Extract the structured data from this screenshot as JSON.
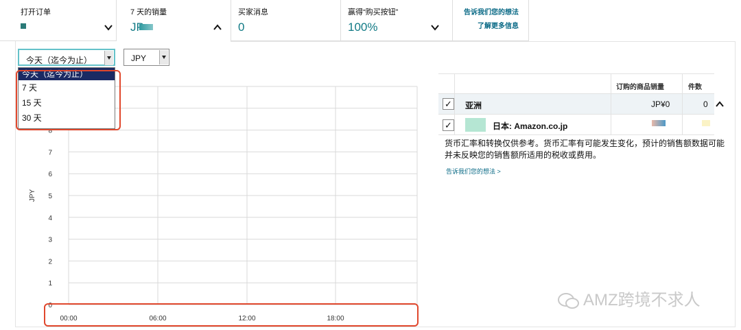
{
  "cards": [
    {
      "title": "打开订单",
      "value": "",
      "expanded": false
    },
    {
      "title": "7 天的销量",
      "value": "JP",
      "expanded": true
    },
    {
      "title": "买家消息",
      "value": "0",
      "expanded": false
    },
    {
      "title": "赢得“购买按钮”",
      "value": "100%",
      "expanded": false
    }
  ],
  "links": {
    "feedback": "告诉我们您的想法",
    "learn_more": "了解更多信息"
  },
  "range_select": {
    "value": "今天（迄今为止）"
  },
  "currency_select": {
    "value": "JPY"
  },
  "dropdown_options": [
    "今天（迄今为止）",
    "7 天",
    "15 天",
    "30 天"
  ],
  "table": {
    "headers": {
      "sales": "订购的商品销量",
      "units": "件数"
    },
    "rows": [
      {
        "label": "亚洲",
        "sales": "JP¥0",
        "units": "0",
        "checked": true
      },
      {
        "label": "日本: Amazon.co.jp",
        "sales": "",
        "units": "",
        "checked": true,
        "swatch": "#b5e6d3"
      }
    ]
  },
  "note": "货币汇率和转换仅供参考。货币汇率有可能发生变化，预计的销售额数据可能并未反映您的销售额所适用的税收或费用。",
  "feedback_link2": "告诉我们您的想法 >",
  "watermark": "AMZ跨境不求人",
  "colors": {
    "accent": "#117a85",
    "annotation": "#e0472c",
    "selected_option": "#1b2a63"
  },
  "chart_data": {
    "type": "line",
    "ylabel": "JPY",
    "ylim": [
      0,
      10
    ],
    "yticks": [
      0,
      1,
      2,
      3,
      4,
      5,
      6,
      7,
      8
    ],
    "xticks": [
      "00:00",
      "06:00",
      "12:00",
      "18:00"
    ],
    "series": [
      {
        "values": [
          0,
          0,
          0,
          0,
          0,
          0,
          0,
          0,
          0,
          0,
          0,
          0,
          0,
          0,
          0,
          0,
          0,
          0,
          0,
          0,
          0,
          0,
          0,
          0
        ]
      }
    ]
  }
}
